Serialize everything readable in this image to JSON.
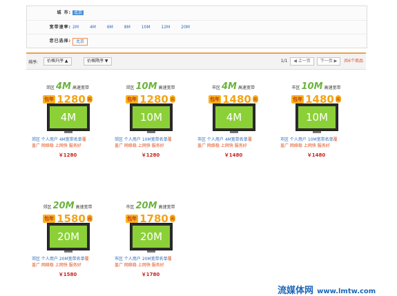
{
  "filters": {
    "city_label": "城 市:",
    "city_value": "北京",
    "speed_label": "宽带速率:",
    "speeds": [
      "2M",
      "4M",
      "6M",
      "8M",
      "10M",
      "12M",
      "20M"
    ],
    "chosen_label": "您已选择:",
    "chosen_value": "北京"
  },
  "sortbar": {
    "label": "排序:",
    "price_asc": "价格升序 ▲",
    "price_desc": "价格降序 ▼",
    "page": "1/1",
    "prev": "◀ 上一页",
    "next": "下一页 ▶",
    "total": "共6个商品"
  },
  "products": [
    {
      "area": "郊区",
      "speed": "4M",
      "suffix": "高速宽带",
      "prefix": "包年",
      "price": "1280",
      "unit": "元",
      "screen": "4M",
      "line1_blue": "郊区 个人用户 4M宽带名单",
      "line1_orange": "覆",
      "line2": "盖广 网络稳 上网快 服务好",
      "final_price": "￥1280"
    },
    {
      "area": "郊区",
      "speed": "10M",
      "suffix": "高速宽带",
      "prefix": "包年",
      "price": "1280",
      "unit": "元",
      "screen": "10M",
      "line1_blue": "郊区 个人用户 10M宽带名单",
      "line1_orange": "覆",
      "line2": "盖广 网络稳 上网快 服务好",
      "final_price": "￥1280"
    },
    {
      "area": "市区",
      "speed": "4M",
      "suffix": "高速宽带",
      "prefix": "包年",
      "price": "1480",
      "unit": "元",
      "screen": "4M",
      "line1_blue": "市区 个人用户 4M宽带名单",
      "line1_orange": "覆",
      "line2": "盖广 网络稳 上网快 服务好",
      "final_price": "￥1480"
    },
    {
      "area": "市区",
      "speed": "10M",
      "suffix": "高速宽带",
      "prefix": "包年",
      "price": "1480",
      "unit": "元",
      "screen": "10M",
      "line1_blue": "市区 个人用户 10M宽带名单",
      "line1_orange": "覆",
      "line2": "盖广 网络稳 上网快 服务好",
      "final_price": "￥1480"
    },
    {
      "area": "郊区",
      "speed": "20M",
      "suffix": "高速宽带",
      "prefix": "包年",
      "price": "1580",
      "unit": "元",
      "screen": "20M",
      "line1_blue": "郊区 个人用户 20M宽带名单",
      "line1_orange": "覆",
      "line2": "盖广 网络稳 上网快 服务好",
      "final_price": "￥1580"
    },
    {
      "area": "市区",
      "speed": "20M",
      "suffix": "高速宽带",
      "prefix": "包年",
      "price": "1780",
      "unit": "元",
      "screen": "20M",
      "line1_blue": "市区 个人用户 20M宽带名单",
      "line1_orange": "覆",
      "line2": "盖广 网络稳 上网快 服务好",
      "final_price": "￥1780"
    }
  ],
  "watermark": {
    "cn": "流媒体网",
    "url": "www.lmtw.com"
  }
}
